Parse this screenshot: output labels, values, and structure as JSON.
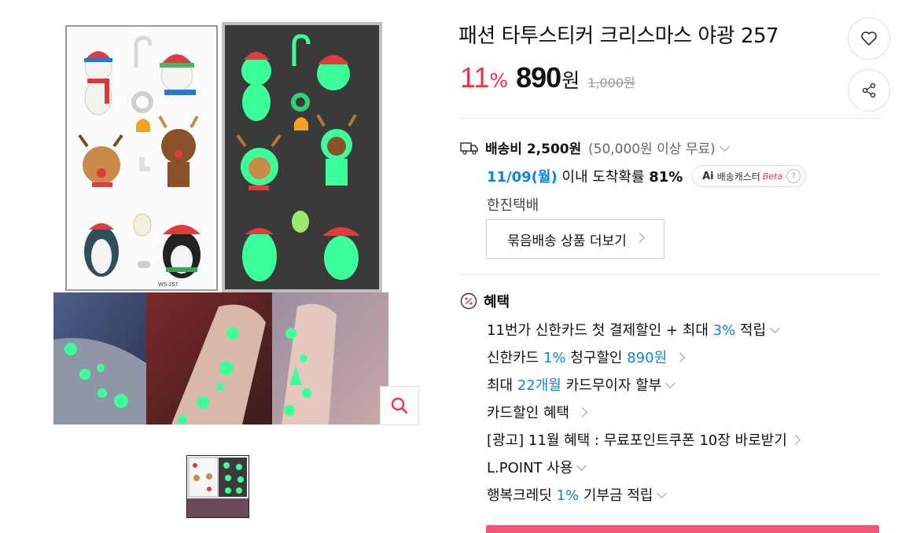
{
  "gallery": {
    "sku_label": "WS-257",
    "zoom_icon": "magnifier-icon",
    "thumbnail_count": 1
  },
  "product": {
    "title": "패션 타투스티커 크리스마스 야광 257",
    "discount_value": "11",
    "discount_pct": "%",
    "price_value": "890",
    "price_unit": "원",
    "original_price": "1,000원",
    "wish_icon": "heart-icon",
    "share_icon": "share-icon"
  },
  "delivery": {
    "icon": "truck-icon",
    "fee_label": "배송비 2,500원",
    "free_condition": "(50,000원 이상 무료)",
    "arrival_date": "11/09(월)",
    "arrival_text": "이내 도착확률",
    "arrival_prob": "81%",
    "ai_label": "Ai",
    "caster_label": "배송캐스터",
    "beta_label": "Beta",
    "help_label": "?",
    "courier": "한진택배",
    "bundle_button": "묶음배송 상품 더보기"
  },
  "benefits": {
    "icon": "percent-icon",
    "title": "혜택",
    "items": [
      {
        "pre": "11번가 신한카드 첫 결제할인 + 최대 ",
        "hl": "3%",
        "post": " 적립",
        "arrow": "down"
      },
      {
        "pre": "신한카드 ",
        "hl": "1%",
        "mid": " 청구할인 ",
        "hl2": "890원",
        "arrow": "right"
      },
      {
        "pre": "최대 ",
        "hl": "22개월",
        "post": " 카드무이자 할부",
        "arrow": "down"
      },
      {
        "pre": "카드할인 혜택",
        "arrow": "right"
      },
      {
        "pre": "[광고] 11월 혜택 : 무료포인트쿠폰 10장 바로받기",
        "arrow": "right"
      },
      {
        "pre": "L.POINT 사용",
        "arrow": "down"
      },
      {
        "pre": "행복크레딧 ",
        "hl": "1%",
        "post": " 기부금 적립",
        "arrow": "down"
      }
    ]
  },
  "colors": {
    "discount": "#f43142",
    "highlight": "#0b83e6",
    "buy_bar": "#f0567a",
    "glow": "#3dff9a"
  }
}
